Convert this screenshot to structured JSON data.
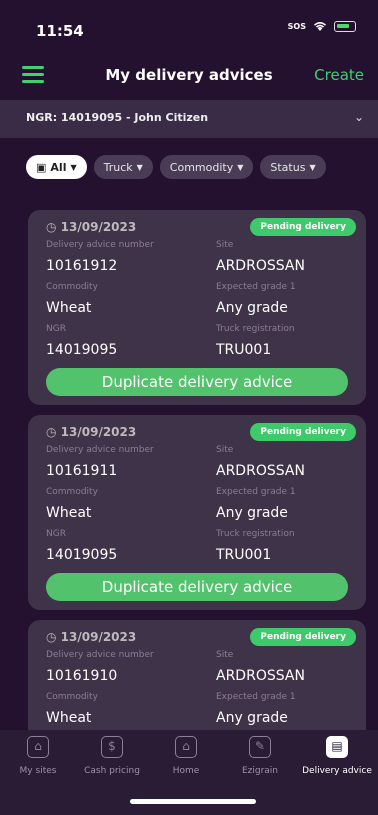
{
  "status": {
    "time": "11:54",
    "sos": "SOS"
  },
  "header": {
    "title": "My delivery advices",
    "create": "Create"
  },
  "ngr": {
    "text": "NGR: 14019095 - John Citizen"
  },
  "filters": [
    {
      "label": "All"
    },
    {
      "label": "Truck"
    },
    {
      "label": "Commodity"
    },
    {
      "label": "Status"
    }
  ],
  "cards": [
    {
      "date": "13/09/2023",
      "status": "Pending delivery",
      "da_label": "Delivery advice number",
      "da": "10161912",
      "site_label": "Site",
      "site": "ARDROSSAN",
      "commodity_label": "Commodity",
      "commodity": "Wheat",
      "grade_label": "Expected grade 1",
      "grade": "Any grade",
      "ngr_label": "NGR",
      "ngr": "14019095",
      "truck_label": "Truck registration",
      "truck": "TRU001",
      "button": "Duplicate delivery advice"
    },
    {
      "date": "13/09/2023",
      "status": "Pending delivery",
      "da_label": "Delivery advice number",
      "da": "10161911",
      "site_label": "Site",
      "site": "ARDROSSAN",
      "commodity_label": "Commodity",
      "commodity": "Wheat",
      "grade_label": "Expected grade 1",
      "grade": "Any grade",
      "ngr_label": "NGR",
      "ngr": "14019095",
      "truck_label": "Truck registration",
      "truck": "TRU001",
      "button": "Duplicate delivery advice"
    },
    {
      "date": "13/09/2023",
      "status": "Pending delivery",
      "da_label": "Delivery advice number",
      "da": "10161910",
      "site_label": "Site",
      "site": "ARDROSSAN",
      "commodity_label": "Commodity",
      "commodity": "Wheat",
      "grade_label": "Expected grade 1",
      "grade": "Any grade"
    }
  ],
  "tabs": [
    {
      "label": "My sites",
      "icon": "sites-icon"
    },
    {
      "label": "Cash pricing",
      "icon": "dollar-icon"
    },
    {
      "label": "Home",
      "icon": "home-icon"
    },
    {
      "label": "Ezigrain",
      "icon": "pencil-icon"
    },
    {
      "label": "Delivery advice",
      "icon": "delivery-advice-icon"
    }
  ],
  "colors": {
    "accent": "#3fd06f",
    "background": "#24112f",
    "card": "#3f3349",
    "badge": "#3ec96a"
  }
}
